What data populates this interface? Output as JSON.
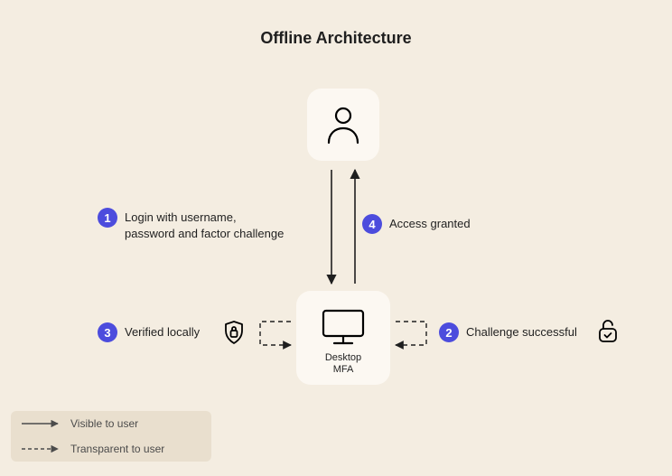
{
  "title": "Offline Architecture",
  "nodes": {
    "user": {
      "name": "user"
    },
    "desktop": {
      "label_line1": "Desktop",
      "label_line2": "MFA"
    }
  },
  "steps": {
    "s1": {
      "num": "1",
      "text_l1": "Login with username,",
      "text_l2": "password and factor challenge"
    },
    "s2": {
      "num": "2",
      "text": "Challenge successful"
    },
    "s3": {
      "num": "3",
      "text": "Verified locally"
    },
    "s4": {
      "num": "4",
      "text": "Access granted"
    }
  },
  "legend": {
    "visible": "Visible to user",
    "transparent": "Transparent to user"
  }
}
